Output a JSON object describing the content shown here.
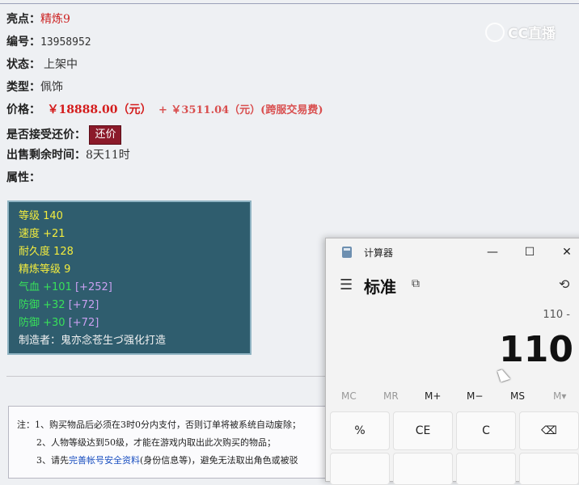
{
  "page": {
    "highlight_label": "亮点：",
    "highlight_value": "精炼9",
    "id_label": "编号：",
    "id_value": "13958952",
    "status_label": "状态：",
    "status_value": "上架中",
    "type_label": "类型：",
    "type_value": "佩饰",
    "price_label": "价格：",
    "price_value": "￥18888.00（元）",
    "price_extra": "+ ￥3511.04（元）(跨服交易费)",
    "bargain_label": "是否接受还价：",
    "bargain_button": "还价",
    "time_label": "出售剩余时间：",
    "time_value": "8天11时",
    "attr_label": "属性："
  },
  "watermark": "CC直播",
  "attributes": {
    "level": "等级 140",
    "speed": "速度 +21",
    "durability": "耐久度 128",
    "refine": "精炼等级 9",
    "blood_base": "气血 +101",
    "blood_extra": "[+252]",
    "def1_base": "防御 +32",
    "def1_extra": "[+72]",
    "def2_base": "防御 +30",
    "def2_extra": "[+72]",
    "maker": "制造者：鬼亦念苍生づ强化打造"
  },
  "notes": {
    "line1": "注：1、购买物品后必须在3时0分内支付，否则订单将被系统自动废除；",
    "line2": "2、人物等级达到50级，才能在游戏内取出此次购买的物品；",
    "line3_prefix": "3、请先",
    "line3_link": "完善帐号安全资料",
    "line3_suffix": "(身份信息等)，避免无法取出角色或被驳"
  },
  "calculator": {
    "title": "计算器",
    "mode": "标准",
    "expression": "110 -",
    "display": "110",
    "memory": [
      "MC",
      "MR",
      "M+",
      "M−",
      "MS",
      "M▾"
    ],
    "keys": [
      "%",
      "CE",
      "C",
      "⌫"
    ],
    "icons": {
      "minimize": "—",
      "maximize": "☐",
      "close": "✕",
      "menu": "☰",
      "keep_on_top": "⧉",
      "history": "⟲"
    }
  }
}
